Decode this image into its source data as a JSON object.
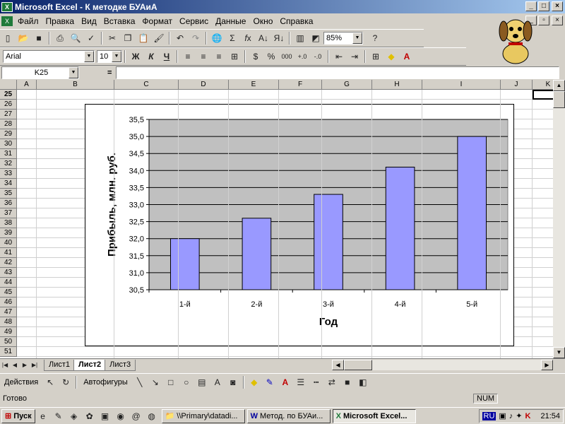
{
  "window": {
    "title": "Microsoft Excel - К методке БУАиА"
  },
  "menu": [
    "Файл",
    "Правка",
    "Вид",
    "Вставка",
    "Формат",
    "Сервис",
    "Данные",
    "Окно",
    "Справка"
  ],
  "toolbar": {
    "zoom": "85%",
    "font": "Arial",
    "size": "10",
    "bold": "Ж",
    "italic": "К",
    "underline": "Ч",
    "percent": "%",
    "thousands": "000"
  },
  "formula_bar": {
    "name_box": "K25",
    "equals": "=",
    "content": ""
  },
  "columns": [
    "A",
    "B",
    "C",
    "D",
    "E",
    "F",
    "G",
    "H",
    "I",
    "J",
    "K"
  ],
  "rows": [
    "25",
    "26",
    "27",
    "28",
    "29",
    "30",
    "31",
    "32",
    "33",
    "34",
    "35",
    "36",
    "37",
    "38",
    "39",
    "40",
    "41",
    "42",
    "43",
    "44",
    "45",
    "46",
    "47",
    "48",
    "49",
    "50",
    "51"
  ],
  "sheets": [
    "Лист1",
    "Лист2",
    "Лист3"
  ],
  "draw": {
    "actions": "Действия",
    "autoshapes": "Автофигуры"
  },
  "status": {
    "ready": "Готово",
    "num": "NUM"
  },
  "taskbar": {
    "start": "Пуск",
    "tasks": [
      "\\\\Primary\\datadi...",
      "Метод. по БУАи...",
      "Microsoft Excel..."
    ],
    "lang": "RU",
    "clock": "21:54"
  },
  "colors": {
    "bar": "#9999ff",
    "plot_bg": "#c0c0c0",
    "title_grad_start": "#0a246a",
    "title_grad_end": "#a6caf0"
  },
  "chart_data": {
    "type": "bar",
    "categories": [
      "1-й",
      "2-й",
      "3-й",
      "4-й",
      "5-й"
    ],
    "values": [
      32.0,
      32.6,
      33.3,
      34.1,
      35.0
    ],
    "xlabel": "Год",
    "ylabel": "Прибыль, млн. руб.",
    "ylim": [
      30.5,
      35.5
    ],
    "yticks": [
      "30,5",
      "31,0",
      "31,5",
      "32,0",
      "32,5",
      "33,0",
      "33,5",
      "34,0",
      "34,5",
      "35,0",
      "35,5"
    ],
    "grid": true
  }
}
